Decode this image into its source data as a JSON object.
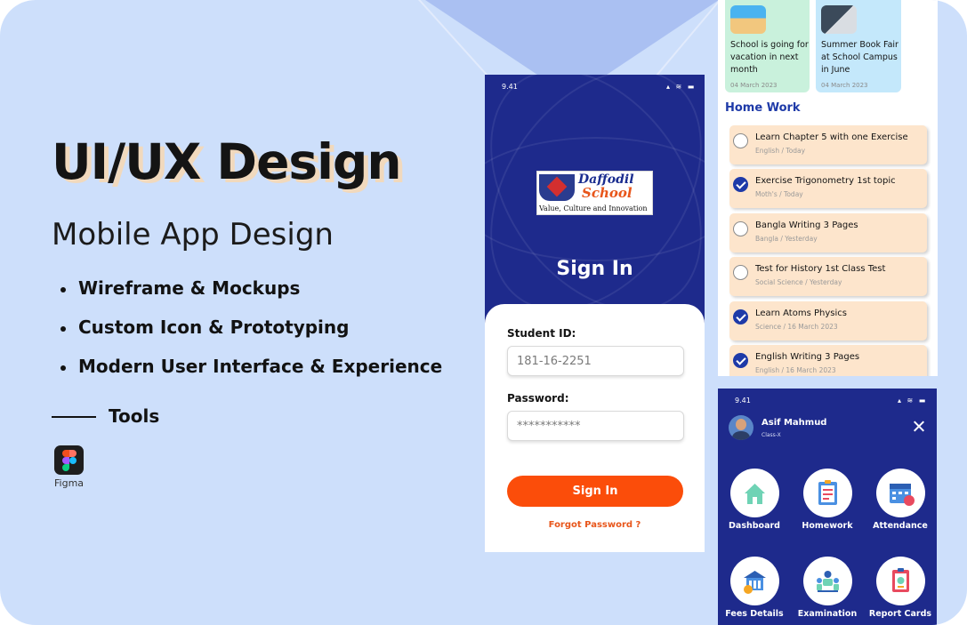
{
  "hero": {
    "title": "UI/UX Design",
    "subtitle": "Mobile App Design",
    "bullets": [
      "Wireframe & Mockups",
      "Custom Icon & Prototyping",
      "Modern User Interface & Experience"
    ],
    "tools_heading": "Tools",
    "tool_name": "Figma"
  },
  "signin": {
    "status_time": "9.41",
    "logo": {
      "name_line1": "Daffodil",
      "name_line2": "School",
      "tagline": "Value, Culture and Innovation"
    },
    "title": "Sign In",
    "student_id_label": "Student ID:",
    "student_id_value": "181-16-2251",
    "password_label": "Password:",
    "password_value": "***********",
    "button_label": "Sign In",
    "forgot_label": "Forgot Password ?"
  },
  "homework_screen": {
    "news": [
      {
        "title": "School is going for vacation in next month",
        "date": "04 March 2023"
      },
      {
        "title": "Summer Book Fair at School Campus in June",
        "date": "04 March 2023"
      }
    ],
    "heading": "Home Work",
    "tasks": [
      {
        "title": "Learn Chapter 5 with one Exercise",
        "subject": "English",
        "when": "Today",
        "done": false
      },
      {
        "title": "Exercise Trigonometry 1st topic",
        "subject": "Moth's",
        "when": "Today",
        "done": true
      },
      {
        "title": "Bangla Writing 3 Pages",
        "subject": "Bangla",
        "when": "Yesterday",
        "done": false
      },
      {
        "title": "Test for History 1st Class Test",
        "subject": "Social Science",
        "when": "Yesterday",
        "done": false
      },
      {
        "title": "Learn Atoms Physics",
        "subject": "Science",
        "when": "16 March 2023",
        "done": true
      },
      {
        "title": "English Writing 3 Pages",
        "subject": "English",
        "when": "16 March 2023",
        "done": true
      }
    ]
  },
  "menu_screen": {
    "status_time": "9.41",
    "user_name": "Asif Mahmud",
    "user_class": "Class-X",
    "items": [
      "Dashboard",
      "Homework",
      "Attendance",
      "Fees Details",
      "Examination",
      "Report Cards"
    ]
  },
  "colors": {
    "background": "#cddffb",
    "primary_navy": "#1e2a8c",
    "accent_orange": "#fb4d0a",
    "task_card": "#fde5cc",
    "heading_blue": "#1e3aa8"
  }
}
